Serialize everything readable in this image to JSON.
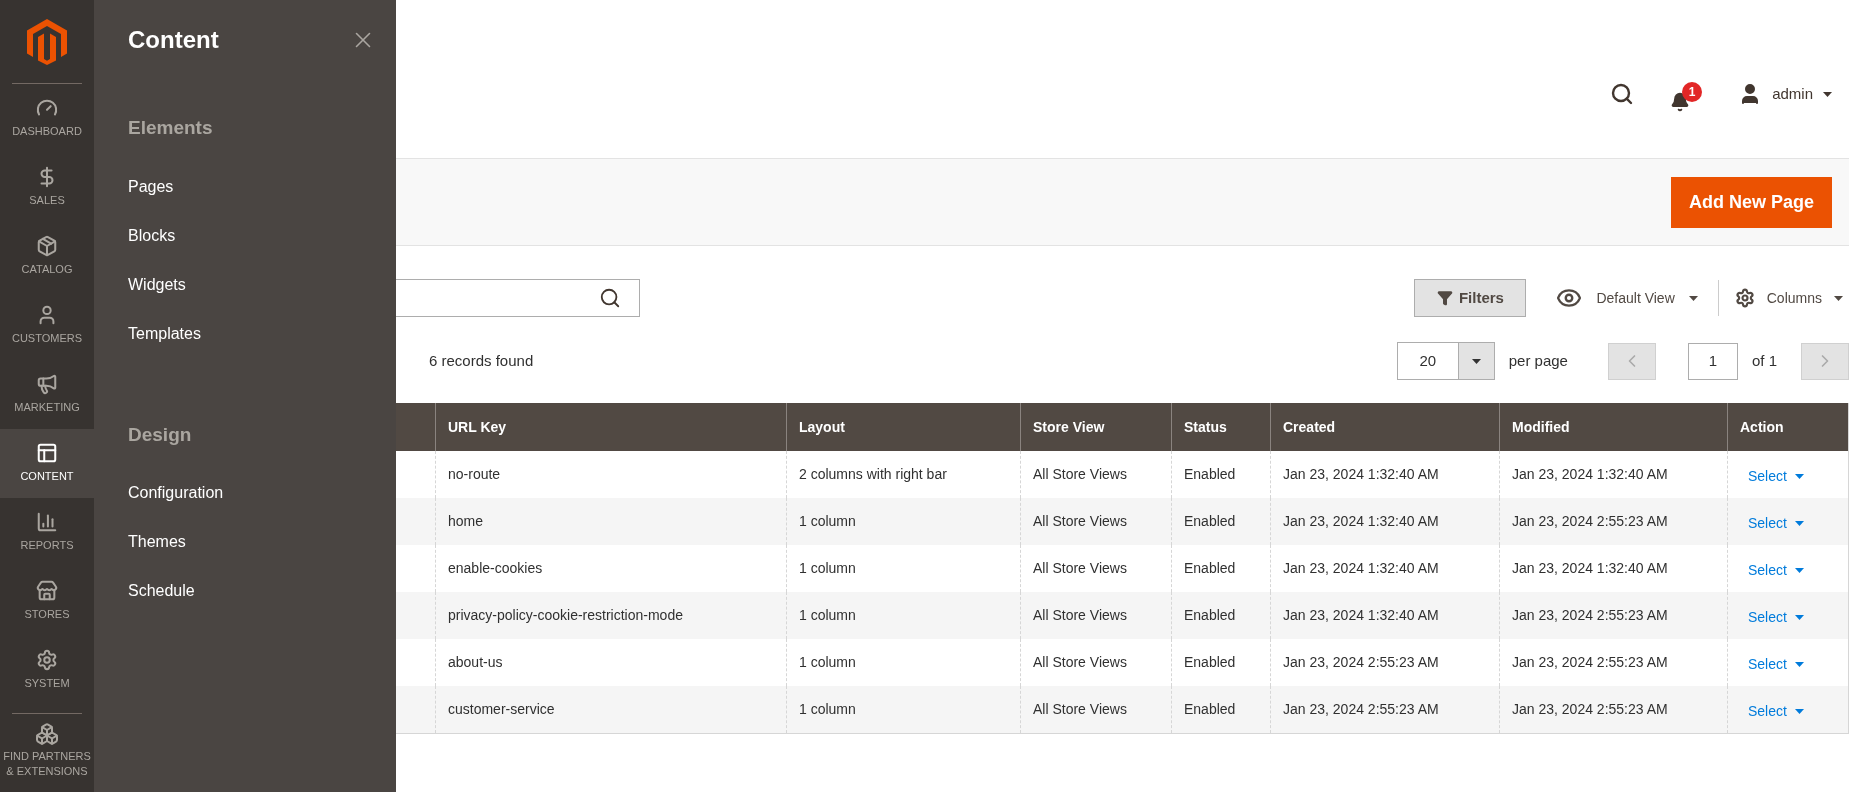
{
  "nav": {
    "items": [
      {
        "label": "DASHBOARD",
        "selected": false
      },
      {
        "label": "SALES",
        "selected": false
      },
      {
        "label": "CATALOG",
        "selected": false
      },
      {
        "label": "CUSTOMERS",
        "selected": false
      },
      {
        "label": "MARKETING",
        "selected": false
      },
      {
        "label": "CONTENT",
        "selected": true
      },
      {
        "label": "REPORTS",
        "selected": false
      },
      {
        "label": "STORES",
        "selected": false
      },
      {
        "label": "SYSTEM",
        "selected": false
      }
    ],
    "extra_item": {
      "label": "FIND PARTNERS & EXTENSIONS"
    }
  },
  "flyout": {
    "title": "Content",
    "sections": [
      {
        "heading": "Elements",
        "items": [
          "Pages",
          "Blocks",
          "Widgets",
          "Templates"
        ]
      },
      {
        "heading": "Design",
        "items": [
          "Configuration",
          "Themes",
          "Schedule"
        ]
      }
    ]
  },
  "header": {
    "notification_count": "1",
    "user": "admin"
  },
  "page_actions": {
    "primary_button": "Add New Page"
  },
  "toolbar": {
    "filters_button": "Filters",
    "view": "Default View",
    "columns_button": "Columns",
    "records": "6 records found",
    "per_page": "20",
    "per_page_label": "per page",
    "page": "1",
    "page_total": "of 1"
  },
  "table": {
    "columns": [
      "URL Key",
      "Layout",
      "Store View",
      "Status",
      "Created",
      "Modified",
      "Action"
    ],
    "rows": [
      {
        "url_key": "no-route",
        "layout": "2 columns with right bar",
        "store_view": "All Store Views",
        "status": "Enabled",
        "created": "Jan 23, 2024 1:32:40 AM",
        "modified": "Jan 23, 2024 1:32:40 AM",
        "action": "Select"
      },
      {
        "url_key": "home",
        "layout": "1 column",
        "store_view": "All Store Views",
        "status": "Enabled",
        "created": "Jan 23, 2024 1:32:40 AM",
        "modified": "Jan 23, 2024 2:55:23 AM",
        "action": "Select"
      },
      {
        "url_key": "enable-cookies",
        "layout": "1 column",
        "store_view": "All Store Views",
        "status": "Enabled",
        "created": "Jan 23, 2024 1:32:40 AM",
        "modified": "Jan 23, 2024 1:32:40 AM",
        "action": "Select"
      },
      {
        "url_key": "privacy-policy-cookie-restriction-mode",
        "layout": "1 column",
        "store_view": "All Store Views",
        "status": "Enabled",
        "created": "Jan 23, 2024 1:32:40 AM",
        "modified": "Jan 23, 2024 2:55:23 AM",
        "action": "Select"
      },
      {
        "url_key": "about-us",
        "layout": "1 column",
        "store_view": "All Store Views",
        "status": "Enabled",
        "created": "Jan 23, 2024 2:55:23 AM",
        "modified": "Jan 23, 2024 2:55:23 AM",
        "action": "Select"
      },
      {
        "url_key": "customer-service",
        "layout": "1 column",
        "store_view": "All Store Views",
        "status": "Enabled",
        "created": "Jan 23, 2024 2:55:23 AM",
        "modified": "Jan 23, 2024 2:55:23 AM",
        "action": "Select"
      }
    ]
  }
}
